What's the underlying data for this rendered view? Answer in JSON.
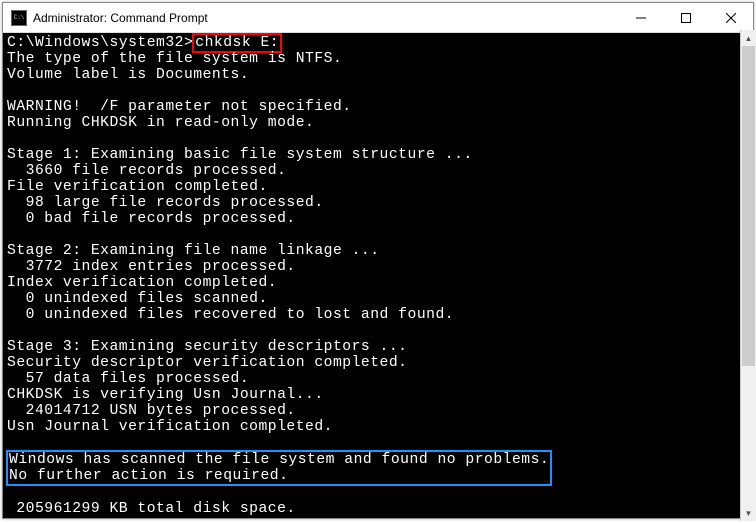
{
  "window": {
    "title": "Administrator: Command Prompt"
  },
  "prompt": {
    "path": "C:\\Windows\\system32>",
    "command": "chkdsk E:"
  },
  "output": {
    "fs_type": "The type of the file system is NTFS.",
    "volume": "Volume label is Documents.",
    "blank1": "",
    "warning": "WARNING!  /F parameter not specified.",
    "mode": "Running CHKDSK in read-only mode.",
    "blank2": "",
    "stage1": "Stage 1: Examining basic file system structure ...",
    "s1_records": "  3660 file records processed.",
    "s1_done": "File verification completed.",
    "s1_large": "  98 large file records processed.",
    "s1_bad": "  0 bad file records processed.",
    "blank3": "",
    "stage2": "Stage 2: Examining file name linkage ...",
    "s2_index": "  3772 index entries processed.",
    "s2_done": "Index verification completed.",
    "s2_unidx": "  0 unindexed files scanned.",
    "s2_recov": "  0 unindexed files recovered to lost and found.",
    "blank4": "",
    "stage3": "Stage 3: Examining security descriptors ...",
    "s3_done": "Security descriptor verification completed.",
    "s3_data": "  57 data files processed.",
    "usn": "CHKDSK is verifying Usn Journal...",
    "usn_bytes": "  24014712 USN bytes processed.",
    "usn_done": "Usn Journal verification completed.",
    "blank5": "",
    "result1": "Windows has scanned the file system and found no problems.",
    "result2": "No further action is required.",
    "blank6": "",
    "disk_space": " 205961299 KB total disk space."
  }
}
